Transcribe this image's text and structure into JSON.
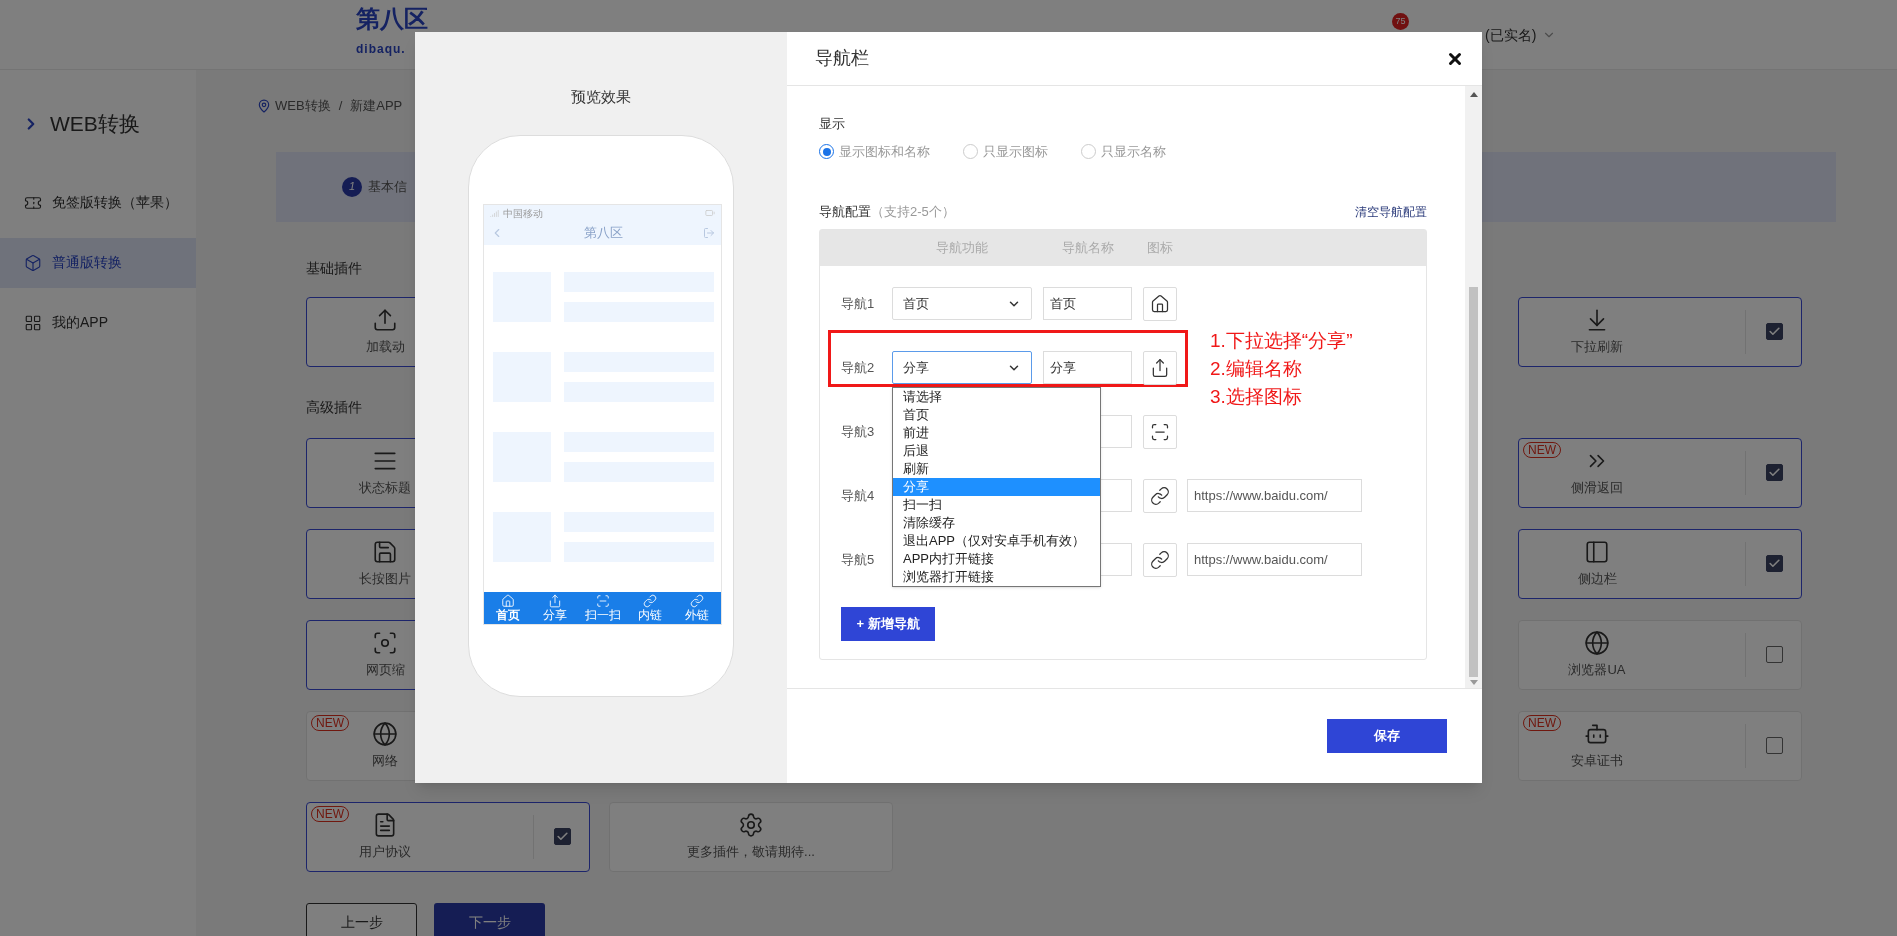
{
  "header": {
    "logo": "第八区",
    "logo_domain": "dibaqu.",
    "notification_count": "75",
    "account_status": "(已实名)"
  },
  "sidebar": {
    "title": "WEB转换",
    "items": [
      {
        "label": "免签版转换（苹果）",
        "selected": false,
        "kind": "ticket"
      },
      {
        "label": "普通版转换",
        "selected": true,
        "kind": "box"
      },
      {
        "label": "我的APP",
        "selected": false,
        "kind": "grid"
      }
    ]
  },
  "breadcrumb": {
    "items": [
      "WEB转换",
      "新建APP"
    ],
    "separator": "/"
  },
  "steps": [
    {
      "number": "1",
      "label": "基本信"
    }
  ],
  "sections": [
    {
      "title": "基础插件",
      "rows": [
        {
          "left": [
            {
              "label": "加载动",
              "kind": "upload",
              "selected": true
            }
          ],
          "right": [
            {
              "label": "下拉刷新",
              "kind": "pull",
              "selected": true,
              "checked": true
            }
          ]
        }
      ]
    },
    {
      "title": "高级插件",
      "rows": [
        {
          "left": [
            {
              "label": "状态标题",
              "kind": "status",
              "selected": true
            }
          ],
          "right": [
            {
              "label": "侧滑返回",
              "kind": "swipe",
              "selected": true,
              "checked": true,
              "badge": "NEW"
            }
          ]
        },
        {
          "left": [
            {
              "label": "长按图片",
              "kind": "save",
              "selected": true
            }
          ],
          "right": [
            {
              "label": "侧边栏",
              "kind": "sidebar",
              "selected": true,
              "checked": true
            }
          ]
        },
        {
          "left": [
            {
              "label": "网页缩",
              "kind": "zoom",
              "selected": true
            }
          ],
          "right": [
            {
              "label": "浏览器UA",
              "kind": "globe",
              "selected": false,
              "checked": false
            }
          ]
        },
        {
          "left": [
            {
              "label": "网络",
              "kind": "globe",
              "selected": false,
              "badge": "NEW"
            }
          ],
          "right": [
            {
              "label": "安卓证书",
              "kind": "android",
              "selected": false,
              "checked": false,
              "badge": "NEW"
            }
          ]
        },
        {
          "left": [
            {
              "label": "用户协议",
              "kind": "doc",
              "selected": true,
              "checked": true,
              "badge": "NEW"
            },
            {
              "label": "更多插件，敬请期待...",
              "kind": "gear",
              "selected": false
            }
          ]
        }
      ]
    }
  ],
  "footer_buttons": [
    {
      "label": "上一步",
      "kind": "outline"
    },
    {
      "label": "下一步",
      "kind": "primary"
    }
  ],
  "modal": {
    "title": "导航栏",
    "preview": {
      "title": "预览效果",
      "carrier": "中国移动",
      "app_title": "第八区",
      "tabs": [
        {
          "label": "首页",
          "kind": "home",
          "selected": true
        },
        {
          "label": "分享",
          "kind": "share",
          "selected": false
        },
        {
          "label": "扫一扫",
          "kind": "scan",
          "selected": false
        },
        {
          "label": "内链",
          "kind": "link",
          "selected": false
        },
        {
          "label": "外链",
          "kind": "link",
          "selected": false
        }
      ]
    },
    "display": {
      "label": "显示",
      "options": [
        {
          "label": "显示图标和名称",
          "selected": true
        },
        {
          "label": "只显示图标",
          "selected": false
        },
        {
          "label": "只显示名称",
          "selected": false
        }
      ]
    },
    "config": {
      "label": "导航配置",
      "hint": "（支持2-5个）",
      "clear_link": "清空导航配置",
      "columns": [
        "导航功能",
        "导航名称",
        "图标"
      ],
      "rows": [
        {
          "label": "导航1",
          "function": "首页",
          "name": "首页",
          "kind": "home",
          "focused": false
        },
        {
          "label": "导航2",
          "function": "分享",
          "name": "分享",
          "kind": "share",
          "focused": true
        },
        {
          "label": "导航3",
          "kind": "scan"
        },
        {
          "label": "导航4",
          "kind": "link",
          "url": "https://www.baidu.com/"
        },
        {
          "label": "导航5",
          "kind": "link",
          "url": "https://www.baidu.com/"
        }
      ],
      "dropdown": [
        {
          "label": "请选择",
          "selected": false
        },
        {
          "label": "首页",
          "selected": false
        },
        {
          "label": "前进",
          "selected": false
        },
        {
          "label": "后退",
          "selected": false
        },
        {
          "label": "刷新",
          "selected": false
        },
        {
          "label": "分享",
          "selected": true
        },
        {
          "label": "扫一扫",
          "selected": false
        },
        {
          "label": "清除缓存",
          "selected": false
        },
        {
          "label": "退出APP（仅对安卓手机有效）",
          "selected": false
        },
        {
          "label": "APP内打开链接",
          "selected": false
        },
        {
          "label": "浏览器打开链接",
          "selected": false
        }
      ],
      "add_button": "+ 新增导航"
    },
    "annotation": [
      "1.下拉选择“分享”",
      "2.编辑名称",
      "3.选择图标"
    ],
    "save_button": "保存"
  }
}
